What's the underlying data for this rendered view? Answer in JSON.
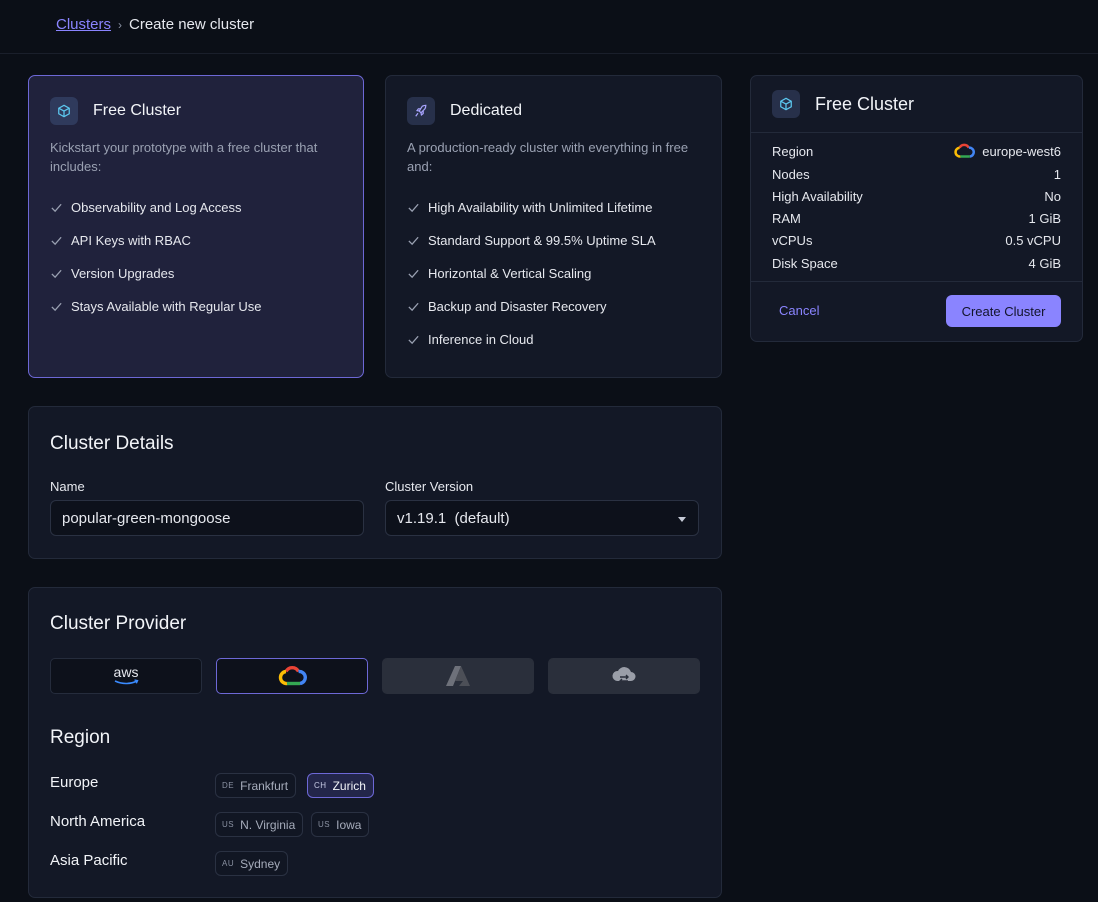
{
  "breadcrumb": {
    "parent": "Clusters",
    "separator": "›",
    "current": "Create new cluster"
  },
  "plans": [
    {
      "title": "Free Cluster",
      "description": "Kickstart your prototype with a free cluster that includes:",
      "features": [
        "Observability and Log Access",
        "API Keys with RBAC",
        "Version Upgrades",
        "Stays Available with Regular Use"
      ],
      "selected": true
    },
    {
      "title": "Dedicated",
      "description": "A production-ready cluster with everything in free and:",
      "features": [
        "High Availability with Unlimited Lifetime",
        "Standard Support & 99.5% Uptime SLA",
        "Horizontal & Vertical Scaling",
        "Backup and Disaster Recovery",
        "Inference in Cloud"
      ],
      "selected": false
    }
  ],
  "details": {
    "title": "Cluster Details",
    "name_label": "Name",
    "name_value": "popular-green-mongoose",
    "version_label": "Cluster Version",
    "version_value": "v1.19.1  (default)"
  },
  "provider": {
    "title": "Cluster Provider",
    "options": [
      {
        "name": "aws",
        "icon": "aws-logo-icon",
        "label": "aws",
        "state": "enabled"
      },
      {
        "name": "gcp",
        "icon": "google-cloud-icon",
        "state": "selected"
      },
      {
        "name": "azure",
        "icon": "azure-icon",
        "state": "disabled"
      },
      {
        "name": "hybrid",
        "icon": "hybrid-cloud-icon",
        "state": "disabled"
      }
    ]
  },
  "region": {
    "title": "Region",
    "groups": [
      {
        "label": "Europe",
        "regions": [
          {
            "code": "DE",
            "name": "Frankfurt",
            "selected": false
          },
          {
            "code": "CH",
            "name": "Zurich",
            "selected": true
          }
        ]
      },
      {
        "label": "North America",
        "regions": [
          {
            "code": "US",
            "name": "N. Virginia",
            "selected": false
          },
          {
            "code": "US",
            "name": "Iowa",
            "selected": false
          }
        ]
      },
      {
        "label": "Asia Pacific",
        "regions": [
          {
            "code": "AU",
            "name": "Sydney",
            "selected": false
          }
        ]
      }
    ]
  },
  "summary": {
    "title": "Free Cluster",
    "rows": [
      {
        "label": "Region",
        "value": "europe-west6"
      },
      {
        "label": "Nodes",
        "value": "1"
      },
      {
        "label": "High Availability",
        "value": "No"
      },
      {
        "label": "RAM",
        "value": "1 GiB"
      },
      {
        "label": "vCPUs",
        "value": "0.5 vCPU"
      },
      {
        "label": "Disk Space",
        "value": "4 GiB"
      }
    ],
    "cancel_label": "Cancel",
    "create_label": "Create Cluster"
  },
  "colors": {
    "accent": "#8a84ff",
    "background": "#0b0f17",
    "card": "#131826",
    "selected_card": "#20223c"
  }
}
